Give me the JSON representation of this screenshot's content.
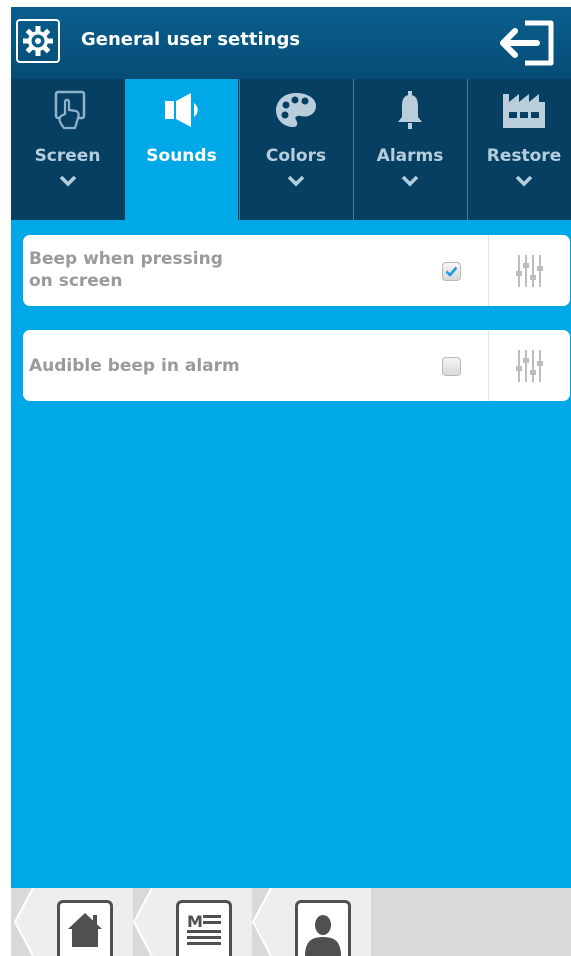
{
  "header": {
    "title": "General user settings"
  },
  "tabs": [
    {
      "label": "Screen",
      "icon": "touch-screen-icon",
      "active": false
    },
    {
      "label": "Sounds",
      "icon": "speaker-icon",
      "active": true
    },
    {
      "label": "Colors",
      "icon": "palette-icon",
      "active": false
    },
    {
      "label": "Alarms",
      "icon": "bell-icon",
      "active": false
    },
    {
      "label": "Restore",
      "icon": "factory-icon",
      "active": false
    }
  ],
  "settings": [
    {
      "label_line1": "Beep when pressing",
      "label_line2": "on screen",
      "checked": true
    },
    {
      "label_line1": "Audible beep in alarm",
      "checked": false
    }
  ],
  "bottom_nav": [
    {
      "icon": "home-icon"
    },
    {
      "icon": "menu-icon",
      "text": "M"
    },
    {
      "icon": "user-icon"
    }
  ],
  "colors": {
    "primary": "#00a8e8",
    "header": "#064d76",
    "tab_bar": "#063f62",
    "check": "#1e9be0"
  }
}
